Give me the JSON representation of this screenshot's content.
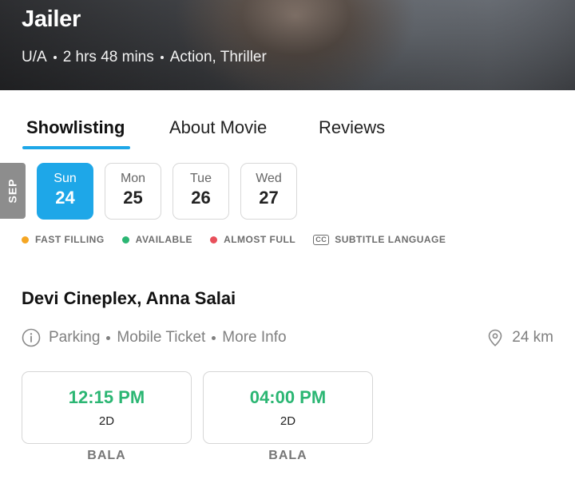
{
  "movie": {
    "title": "Jailer",
    "certification": "U/A",
    "duration": "2 hrs 48 mins",
    "genres": "Action, Thriller"
  },
  "tabs": [
    {
      "label": "Showlisting",
      "active": true
    },
    {
      "label": "About Movie",
      "active": false
    },
    {
      "label": "Reviews",
      "active": false
    }
  ],
  "month": "SEP",
  "dates": [
    {
      "dow": "Sun",
      "day": "24",
      "selected": true
    },
    {
      "dow": "Mon",
      "day": "25",
      "selected": false
    },
    {
      "dow": "Tue",
      "day": "26",
      "selected": false
    },
    {
      "dow": "Wed",
      "day": "27",
      "selected": false
    }
  ],
  "legend": [
    {
      "label": "FAST FILLING",
      "color": "#f5a623"
    },
    {
      "label": "AVAILABLE",
      "color": "#2bb673"
    },
    {
      "label": "ALMOST FULL",
      "color": "#e8505b"
    },
    {
      "label": "SUBTITLE LANGUAGE",
      "icon": "cc-icon",
      "icon_text": "CC"
    }
  ],
  "theatre": {
    "name": "Devi Cineplex, Anna Salai",
    "amenities": [
      "Parking",
      "Mobile Ticket",
      "More Info"
    ],
    "distance": "24 km"
  },
  "showtimes": [
    {
      "time": "12:15 PM",
      "format": "2D",
      "screen": "BALA"
    },
    {
      "time": "04:00 PM",
      "format": "2D",
      "screen": "BALA"
    }
  ],
  "colors": {
    "accent": "#1ea7e8",
    "available_time": "#2bb673"
  }
}
